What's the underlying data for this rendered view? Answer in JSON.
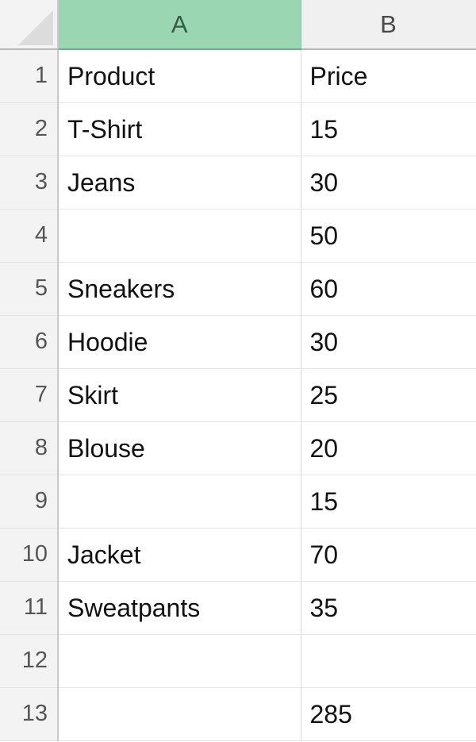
{
  "app": {
    "type": "spreadsheet",
    "selected_column": "A"
  },
  "colors": {
    "selected_header_bg": "#9bd6b2",
    "selected_header_text": "#2f5d45",
    "header_bg": "#f0f0f0",
    "header_text": "#4a4a4a",
    "gutter_bg": "#f3f3f3",
    "gridline": "#e4e4e4",
    "cell_text": "#111111"
  },
  "corner": {
    "icon": "select-all-triangle-icon"
  },
  "columns": [
    {
      "id": "A",
      "label": "A",
      "selected": true
    },
    {
      "id": "B",
      "label": "B",
      "selected": false
    }
  ],
  "rows": [
    {
      "num": "1",
      "a": "Product",
      "b": "Price"
    },
    {
      "num": "2",
      "a": "T-Shirt",
      "b": "15"
    },
    {
      "num": "3",
      "a": "Jeans",
      "b": "30"
    },
    {
      "num": "4",
      "a": "",
      "b": "50"
    },
    {
      "num": "5",
      "a": "Sneakers",
      "b": "60"
    },
    {
      "num": "6",
      "a": "Hoodie",
      "b": "30"
    },
    {
      "num": "7",
      "a": "Skirt",
      "b": "25"
    },
    {
      "num": "8",
      "a": "Blouse",
      "b": "20"
    },
    {
      "num": "9",
      "a": "",
      "b": "15"
    },
    {
      "num": "10",
      "a": "Jacket",
      "b": "70"
    },
    {
      "num": "11",
      "a": "Sweatpants",
      "b": "35"
    },
    {
      "num": "12",
      "a": "",
      "b": ""
    },
    {
      "num": "13",
      "a": "",
      "b": "285"
    }
  ]
}
